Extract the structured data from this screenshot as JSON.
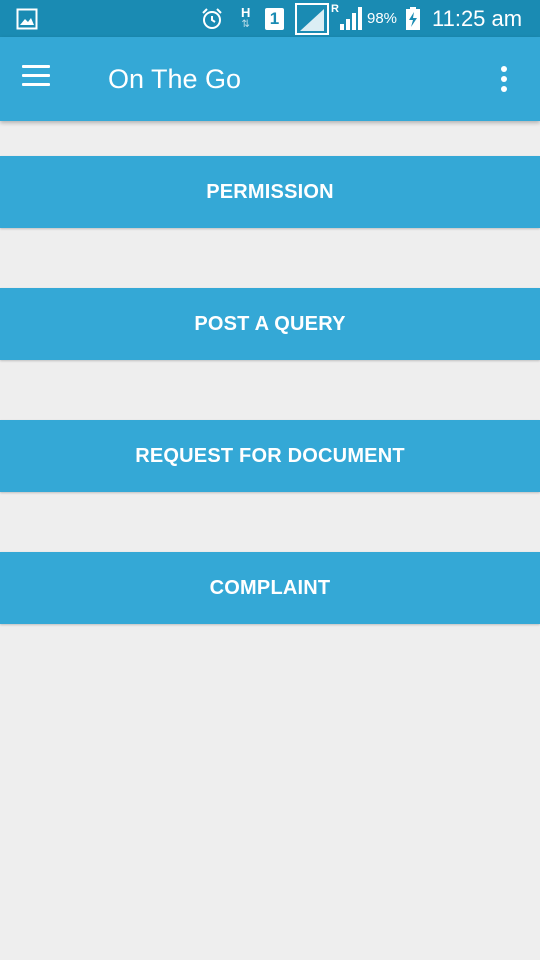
{
  "status_bar": {
    "icons": [
      "gallery-icon",
      "alarm-icon",
      "data-h-icon",
      "sim-1-icon",
      "wifi-signal-icon",
      "cell-signal-icon",
      "battery-charging-icon"
    ],
    "data_type": "H",
    "sim_slot": "1",
    "roaming": "R",
    "battery": "98%",
    "time": "11:25 am"
  },
  "app_bar": {
    "title": "On The Go",
    "icons": [
      "menu-icon",
      "overflow-icon"
    ]
  },
  "buttons": [
    "PERMISSION",
    "POST A QUERY",
    "REQUEST FOR DOCUMENT",
    "COMPLAINT"
  ],
  "colors": {
    "status_bar": "#1a8bb3",
    "primary": "#34a8d6",
    "background": "#eeeeee",
    "text": "#ffffff"
  }
}
